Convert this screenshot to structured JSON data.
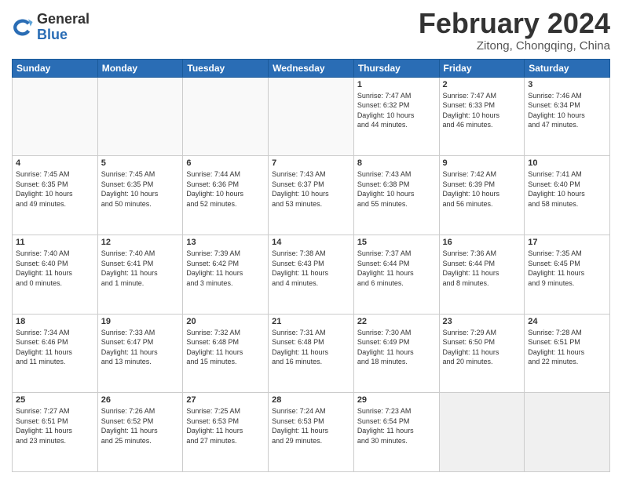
{
  "header": {
    "logo": {
      "general": "General",
      "blue": "Blue"
    },
    "title": "February 2024",
    "location": "Zitong, Chongqing, China"
  },
  "days_of_week": [
    "Sunday",
    "Monday",
    "Tuesday",
    "Wednesday",
    "Thursday",
    "Friday",
    "Saturday"
  ],
  "weeks": [
    [
      {
        "day": "",
        "info": ""
      },
      {
        "day": "",
        "info": ""
      },
      {
        "day": "",
        "info": ""
      },
      {
        "day": "",
        "info": ""
      },
      {
        "day": "1",
        "info": "Sunrise: 7:47 AM\nSunset: 6:32 PM\nDaylight: 10 hours\nand 44 minutes."
      },
      {
        "day": "2",
        "info": "Sunrise: 7:47 AM\nSunset: 6:33 PM\nDaylight: 10 hours\nand 46 minutes."
      },
      {
        "day": "3",
        "info": "Sunrise: 7:46 AM\nSunset: 6:34 PM\nDaylight: 10 hours\nand 47 minutes."
      }
    ],
    [
      {
        "day": "4",
        "info": "Sunrise: 7:45 AM\nSunset: 6:35 PM\nDaylight: 10 hours\nand 49 minutes."
      },
      {
        "day": "5",
        "info": "Sunrise: 7:45 AM\nSunset: 6:35 PM\nDaylight: 10 hours\nand 50 minutes."
      },
      {
        "day": "6",
        "info": "Sunrise: 7:44 AM\nSunset: 6:36 PM\nDaylight: 10 hours\nand 52 minutes."
      },
      {
        "day": "7",
        "info": "Sunrise: 7:43 AM\nSunset: 6:37 PM\nDaylight: 10 hours\nand 53 minutes."
      },
      {
        "day": "8",
        "info": "Sunrise: 7:43 AM\nSunset: 6:38 PM\nDaylight: 10 hours\nand 55 minutes."
      },
      {
        "day": "9",
        "info": "Sunrise: 7:42 AM\nSunset: 6:39 PM\nDaylight: 10 hours\nand 56 minutes."
      },
      {
        "day": "10",
        "info": "Sunrise: 7:41 AM\nSunset: 6:40 PM\nDaylight: 10 hours\nand 58 minutes."
      }
    ],
    [
      {
        "day": "11",
        "info": "Sunrise: 7:40 AM\nSunset: 6:40 PM\nDaylight: 11 hours\nand 0 minutes."
      },
      {
        "day": "12",
        "info": "Sunrise: 7:40 AM\nSunset: 6:41 PM\nDaylight: 11 hours\nand 1 minute."
      },
      {
        "day": "13",
        "info": "Sunrise: 7:39 AM\nSunset: 6:42 PM\nDaylight: 11 hours\nand 3 minutes."
      },
      {
        "day": "14",
        "info": "Sunrise: 7:38 AM\nSunset: 6:43 PM\nDaylight: 11 hours\nand 4 minutes."
      },
      {
        "day": "15",
        "info": "Sunrise: 7:37 AM\nSunset: 6:44 PM\nDaylight: 11 hours\nand 6 minutes."
      },
      {
        "day": "16",
        "info": "Sunrise: 7:36 AM\nSunset: 6:44 PM\nDaylight: 11 hours\nand 8 minutes."
      },
      {
        "day": "17",
        "info": "Sunrise: 7:35 AM\nSunset: 6:45 PM\nDaylight: 11 hours\nand 9 minutes."
      }
    ],
    [
      {
        "day": "18",
        "info": "Sunrise: 7:34 AM\nSunset: 6:46 PM\nDaylight: 11 hours\nand 11 minutes."
      },
      {
        "day": "19",
        "info": "Sunrise: 7:33 AM\nSunset: 6:47 PM\nDaylight: 11 hours\nand 13 minutes."
      },
      {
        "day": "20",
        "info": "Sunrise: 7:32 AM\nSunset: 6:48 PM\nDaylight: 11 hours\nand 15 minutes."
      },
      {
        "day": "21",
        "info": "Sunrise: 7:31 AM\nSunset: 6:48 PM\nDaylight: 11 hours\nand 16 minutes."
      },
      {
        "day": "22",
        "info": "Sunrise: 7:30 AM\nSunset: 6:49 PM\nDaylight: 11 hours\nand 18 minutes."
      },
      {
        "day": "23",
        "info": "Sunrise: 7:29 AM\nSunset: 6:50 PM\nDaylight: 11 hours\nand 20 minutes."
      },
      {
        "day": "24",
        "info": "Sunrise: 7:28 AM\nSunset: 6:51 PM\nDaylight: 11 hours\nand 22 minutes."
      }
    ],
    [
      {
        "day": "25",
        "info": "Sunrise: 7:27 AM\nSunset: 6:51 PM\nDaylight: 11 hours\nand 23 minutes."
      },
      {
        "day": "26",
        "info": "Sunrise: 7:26 AM\nSunset: 6:52 PM\nDaylight: 11 hours\nand 25 minutes."
      },
      {
        "day": "27",
        "info": "Sunrise: 7:25 AM\nSunset: 6:53 PM\nDaylight: 11 hours\nand 27 minutes."
      },
      {
        "day": "28",
        "info": "Sunrise: 7:24 AM\nSunset: 6:53 PM\nDaylight: 11 hours\nand 29 minutes."
      },
      {
        "day": "29",
        "info": "Sunrise: 7:23 AM\nSunset: 6:54 PM\nDaylight: 11 hours\nand 30 minutes."
      },
      {
        "day": "",
        "info": ""
      },
      {
        "day": "",
        "info": ""
      }
    ]
  ]
}
